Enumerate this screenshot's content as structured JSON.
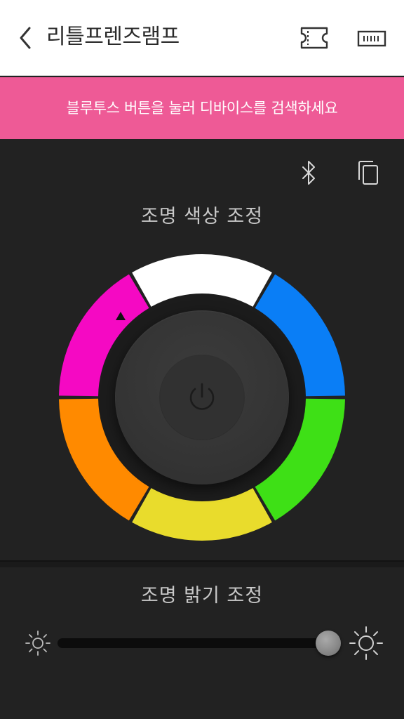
{
  "header": {
    "title": "리틀프렌즈램프",
    "back_icon": "chevron-left-icon",
    "ticket_icon": "ticket-icon",
    "battery_icon": "battery-icon"
  },
  "banner": {
    "text": "블루투스 버튼을 눌러 디바이스를 검색하세요",
    "color": "#ee5a96"
  },
  "color_panel": {
    "title": "조명 색상 조정",
    "bluetooth_icon": "bluetooth-icon",
    "copy_icon": "copy-icon",
    "segments": [
      {
        "name": "white",
        "color": "#ffffff"
      },
      {
        "name": "blue",
        "color": "#0a7ef6"
      },
      {
        "name": "green",
        "color": "#3ee016"
      },
      {
        "name": "yellow",
        "color": "#e9dc2c"
      },
      {
        "name": "orange",
        "color": "#ff8a00"
      },
      {
        "name": "magenta",
        "color": "#f509c3"
      }
    ],
    "power_icon": "power-icon"
  },
  "brightness_panel": {
    "title": "조명 밝기 조정",
    "level": 0.96,
    "min_icon": "sun-small-icon",
    "max_icon": "sun-large-icon"
  }
}
